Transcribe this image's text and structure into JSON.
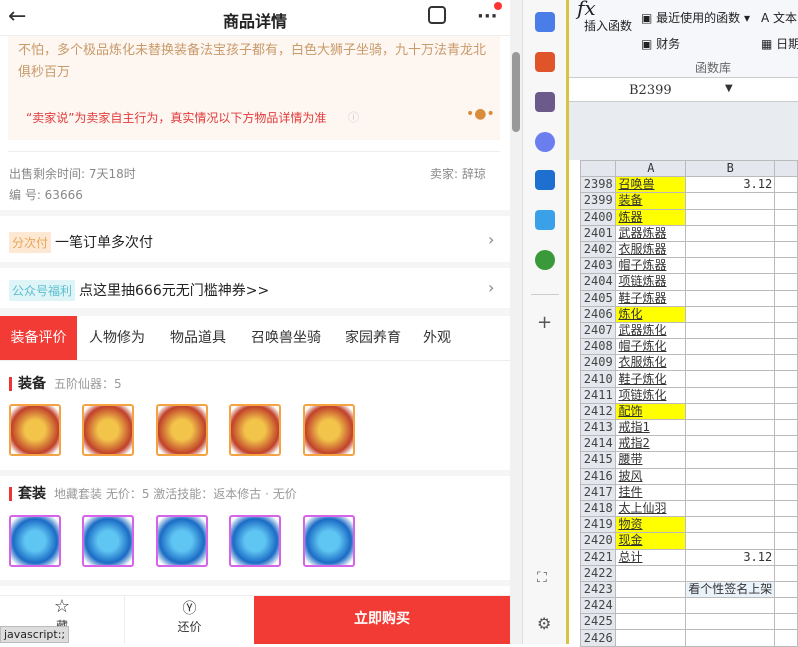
{
  "header": {
    "title": "商品详情",
    "back": "arrow-left-icon",
    "share": "share-icon",
    "more": "more-icon"
  },
  "seller_says": {
    "text": "不怕，多个极品炼化未替换装备法宝孩子都有，白色大狮子坐骑，九十万法青龙北俱秒百万",
    "note": "“卖家说”为卖家自主行为，真实情况以下方物品详情为准"
  },
  "info": {
    "remaining": "出售剩余时间: 7天18时",
    "id": "编 号: 63666",
    "seller": "卖家: 辞琼"
  },
  "rows": [
    {
      "tag": "分次付",
      "text": "一笔订单多次付"
    },
    {
      "tag": "公众号福利",
      "text": "点这里抽666元无门槛神券>>"
    }
  ],
  "tabs": [
    "装备评价",
    "人物修为",
    "物品道具",
    "召唤兽坐骑",
    "家园养育",
    "外观"
  ],
  "equip": {
    "title": "装备",
    "sub": "五阶仙器：5"
  },
  "suit": {
    "title": "套装",
    "sub": "地藏套装   无价：5   激活技能：返本修古 · 无价"
  },
  "bottom": {
    "fav": "藏",
    "bargain": "还价",
    "buy": "立即购买",
    "status": "javascript:;"
  },
  "excel": {
    "ribbon": {
      "insert_fn": "插入函数",
      "recent": "最近使用的函数",
      "text": "文本",
      "finance": "财务",
      "date": "日期",
      "group": "函数库"
    },
    "namebox": "B2399",
    "cols": [
      "A",
      "B"
    ],
    "rows": [
      {
        "n": "2398",
        "a": "召唤兽",
        "b": "3.12",
        "y": true
      },
      {
        "n": "2399",
        "a": "装备",
        "b": "",
        "y": true
      },
      {
        "n": "2400",
        "a": "炼器",
        "b": "",
        "y": true
      },
      {
        "n": "2401",
        "a": "武器炼器",
        "b": ""
      },
      {
        "n": "2402",
        "a": "衣服炼器",
        "b": ""
      },
      {
        "n": "2403",
        "a": "帽子炼器",
        "b": ""
      },
      {
        "n": "2404",
        "a": "项链炼器",
        "b": ""
      },
      {
        "n": "2405",
        "a": "鞋子炼器",
        "b": ""
      },
      {
        "n": "2406",
        "a": "炼化",
        "b": "",
        "y": true
      },
      {
        "n": "2407",
        "a": "武器炼化",
        "b": ""
      },
      {
        "n": "2408",
        "a": "帽子炼化",
        "b": ""
      },
      {
        "n": "2409",
        "a": "衣服炼化",
        "b": ""
      },
      {
        "n": "2410",
        "a": "鞋子炼化",
        "b": ""
      },
      {
        "n": "2411",
        "a": "项链炼化",
        "b": ""
      },
      {
        "n": "2412",
        "a": "配饰",
        "b": "",
        "y": true
      },
      {
        "n": "2413",
        "a": "戒指1",
        "b": ""
      },
      {
        "n": "2414",
        "a": "戒指2",
        "b": ""
      },
      {
        "n": "2415",
        "a": "腰带",
        "b": ""
      },
      {
        "n": "2416",
        "a": "披风",
        "b": ""
      },
      {
        "n": "2417",
        "a": "挂件",
        "b": ""
      },
      {
        "n": "2418",
        "a": "太上仙羽",
        "b": ""
      },
      {
        "n": "2419",
        "a": "物资",
        "b": "",
        "y": true
      },
      {
        "n": "2420",
        "a": "现金",
        "b": "",
        "y": true
      },
      {
        "n": "2421",
        "a": "总计",
        "b": "3.12"
      },
      {
        "n": "2422",
        "a": "",
        "b": ""
      },
      {
        "n": "2423",
        "a": "",
        "b": "看个性签名上架"
      },
      {
        "n": "2424",
        "a": "",
        "b": ""
      },
      {
        "n": "2425",
        "a": "",
        "b": ""
      },
      {
        "n": "2426",
        "a": "",
        "b": ""
      }
    ]
  }
}
